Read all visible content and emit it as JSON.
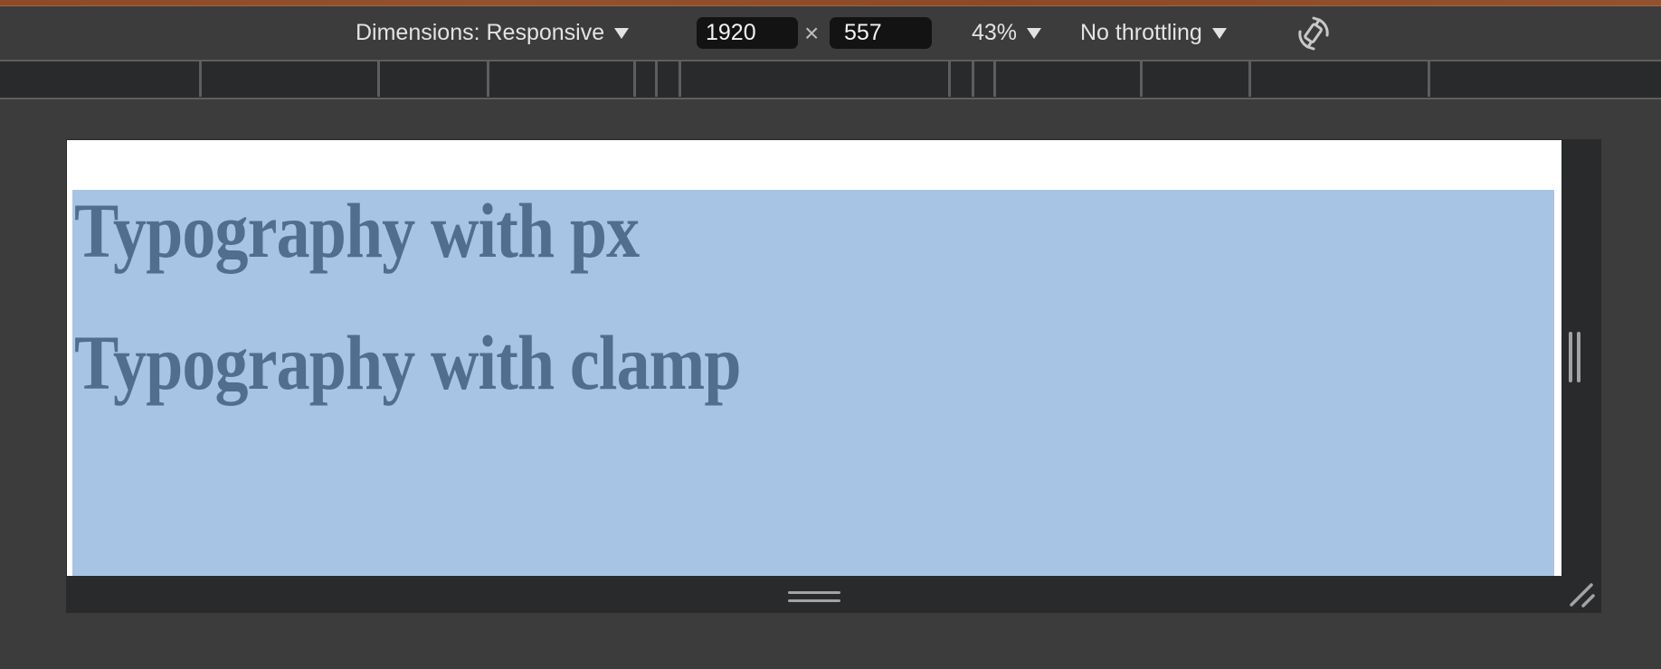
{
  "toolbar": {
    "dimensions_label": "Dimensions: Responsive",
    "width_value": "1920",
    "times_symbol": "×",
    "height_value": "557",
    "zoom_label": "43%",
    "throttling_label": "No throttling",
    "rotate_icon": "rotate-icon"
  },
  "media_query_bar": {
    "breakpoint_count": 12
  },
  "page": {
    "heading_px": "Typography with px",
    "heading_clamp": "Typography with clamp"
  },
  "colors": {
    "toolbar_bg": "#3c3c3c",
    "frame_bg": "#292a2c",
    "content_bg": "#a7c4e4",
    "heading_color": "#516e8e",
    "accent_strip": "#8e4c2a"
  }
}
